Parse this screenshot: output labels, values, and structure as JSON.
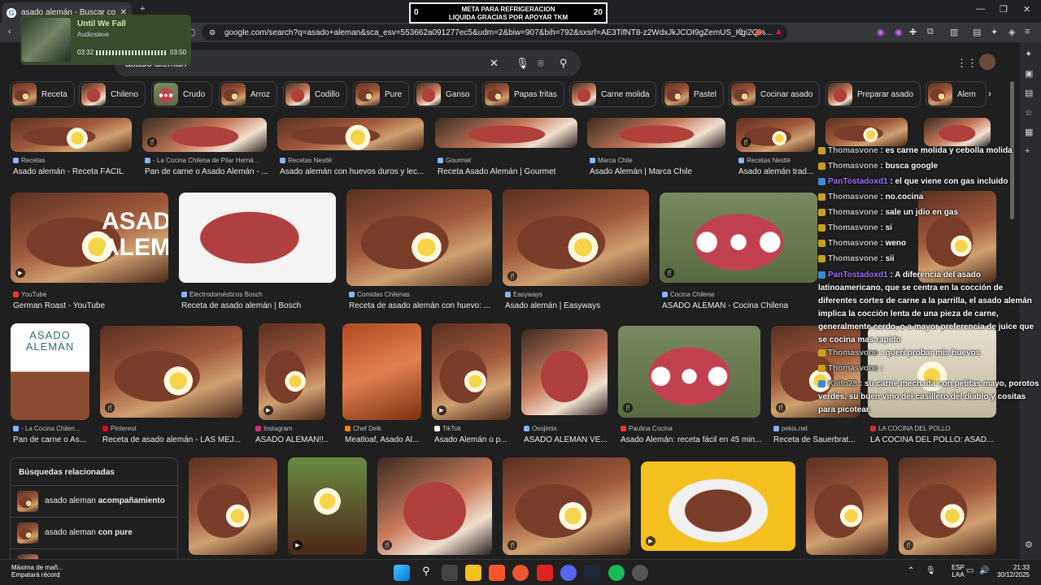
{
  "browser": {
    "tab_title": "asado alemán - Buscar con Goo",
    "url": "google.com/search?q=asado+aleman&sca_esv=553662a091277ec5&udm=2&biw=907&bih=792&sxsrf=AE3TifNT8-z2WdxJkJCOI9gZemUS_Kgi2Q%..."
  },
  "overlay_meta": {
    "title_line1": "META PARA REFRIGERACION",
    "title_line2": "LIQUIDA GRACIAS POR APOYAR TKM",
    "left": "0",
    "right": "20"
  },
  "player": {
    "title": "Until We Fall",
    "artist": "Audioslave",
    "elapsed": "03:32",
    "total": "03:50"
  },
  "search": {
    "query": "asado aleman"
  },
  "chips": [
    "Receta",
    "Chileno",
    "Crudo",
    "Arroz",
    "Codillo",
    "Pure",
    "Ganso",
    "Papas fritas",
    "Carne molida",
    "Pastel",
    "Cocinar asado",
    "Preparar asado",
    "Alem"
  ],
  "row1": [
    {
      "source": "Recetas",
      "caption": "Asado alemán - Receta FÁCIL"
    },
    {
      "source": "- La Cocina Chilena de Pilar Herná...",
      "caption": "Pan de carne o Asado Alemán - ..."
    },
    {
      "source": "Recetas Nestlé",
      "caption": "Asado alemán con huevos duros y lec..."
    },
    {
      "source": "Gourmet",
      "caption": "Receta Asado Alemán | Gourmet"
    },
    {
      "source": "Marca Chile",
      "caption": "Asado Alemán | Marca Chile"
    },
    {
      "source": "Recetas Nestlé",
      "caption": "Asado alemán trad..."
    }
  ],
  "row2": [
    {
      "source": "YouTube",
      "caption": "German Roast - YouTube"
    },
    {
      "source": "Electrodomésticos Bosch",
      "caption": "Receta de asado alemán | Bosch"
    },
    {
      "source": "Comidas Chilenas",
      "caption": "Receta de asado alemán con huevo: ..."
    },
    {
      "source": "Easyways",
      "caption": "Asado alemán | Easyways"
    },
    {
      "source": "Cocina Chilena",
      "caption": "ASADO ALEMAN - Cocina Chilena"
    }
  ],
  "row3": [
    {
      "source": "- La Cocina Chilen...",
      "caption": "Pan de carne o As..."
    },
    {
      "source": "Pinterest",
      "caption": "Receta de asado alemán - LAS MEJ..."
    },
    {
      "source": "Instagram",
      "caption": "ASADO ALEMÁN!!..."
    },
    {
      "source": "Chef Delk",
      "caption": "Meatloaf, Asado Al..."
    },
    {
      "source": "TikTok",
      "caption": "Asado Alemán o p..."
    },
    {
      "source": "Osojimix",
      "caption": "ASADO ALEMAN VE..."
    },
    {
      "source": "Paulina Cocina",
      "caption": "Asado Alemán: receta fácil en 45 min..."
    },
    {
      "source": "pekis.net",
      "caption": "Receta de Sauerbrat..."
    },
    {
      "source": "LA COCINA DEL POLLO",
      "caption": "LA COCINA DEL POLLO: ASAD..."
    }
  ],
  "asado_text": {
    "line1": "ASADO",
    "line2": "ALEMÁN"
  },
  "card_text": {
    "line1": "ASADO",
    "line2": "ALEMÁN"
  },
  "related": {
    "title": "Búsquedas relacionadas",
    "items": [
      {
        "prefix": "asado aleman ",
        "bold": "acompañamiento"
      },
      {
        "prefix": "asado aleman ",
        "bold": "con pure"
      }
    ]
  },
  "chat": [
    {
      "user": "Thomasvone",
      "text": " : es carne molida y cebolla molida"
    },
    {
      "user": "Thomasvone",
      "text": " : busca google"
    },
    {
      "user": "PanTostadoxd1",
      "text": " : el que viene con gas incluido"
    },
    {
      "user": "Thomasvone",
      "text": " : no.cocina"
    },
    {
      "user": "Thomasvone",
      "text": " : sale un jdio en gas"
    },
    {
      "user": "Thomasvone",
      "text": " : si"
    },
    {
      "user": "Thomasvone",
      "text": " : weno"
    },
    {
      "user": "Thomasvone",
      "text": " : sii"
    },
    {
      "user": "PanTostadoxd1",
      "text": " : A diferencia del asado latinoamericano, que se centra en la cocción de diferentes cortes de carne a la parrilla, el asado alemán implica la cocción lenta de una pieza de carne, generalmente cerdo, o a mayor preferencia de juice        que se cocina mas rapido"
    },
    {
      "user": "Thomasvone",
      "text": " : queri probar mis huevos"
    },
    {
      "user": "Thomasvone",
      "text": " :"
    },
    {
      "user": "Kaito28",
      "text": " : su carne mechada con petitas mayo, porotos verdes, su buen vino del casillero del diablo y cositas para picotear."
    }
  ],
  "taskbar": {
    "weather_line1": "Máxima de mañ...",
    "weather_line2": "Empatará récord",
    "lang1": "ESP",
    "lang2": "LAA",
    "time": "21:33",
    "date": "30/12/2025"
  }
}
